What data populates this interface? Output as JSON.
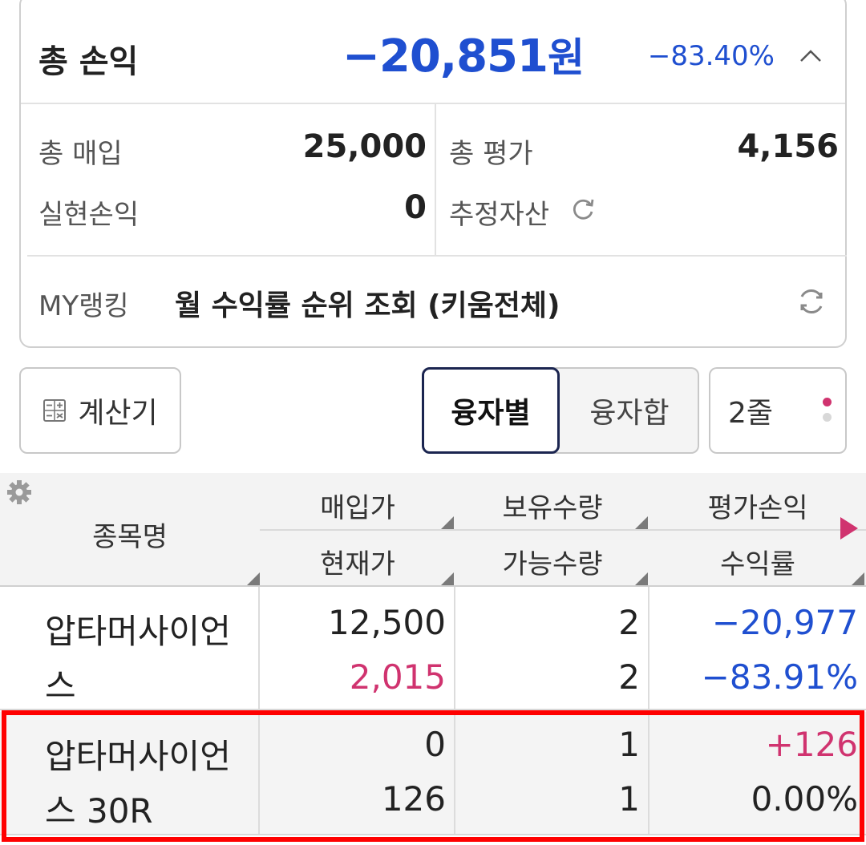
{
  "summary": {
    "total_label": "총 손익",
    "total_amount": "−20,851",
    "total_unit": "원",
    "total_rate": "−83.40%",
    "purchase_label": "총 매입",
    "purchase_value": "25,000",
    "eval_label": "총 평가",
    "eval_value": "4,156",
    "realized_label": "실현손익",
    "realized_value": "0",
    "est_asset_label": "추정자산"
  },
  "ranking": {
    "label": "MY랭킹",
    "text": "월 수익률 순위 조회 (키움전체)"
  },
  "controls": {
    "calculator": "계산기",
    "seg_a": "융자별",
    "seg_b": "융자합",
    "lines": "2줄"
  },
  "table": {
    "headers": {
      "name": "종목명",
      "buy_price": "매입가",
      "current_price": "현재가",
      "holding_qty": "보유수량",
      "available_qty": "가능수량",
      "eval_pl": "평가손익",
      "return_rate": "수익률"
    },
    "rows": [
      {
        "name": "압타머사이언스",
        "buy_price": "12,500",
        "current_price": "2,015",
        "holding_qty": "2",
        "available_qty": "2",
        "eval_pl": "−20,977",
        "return_rate": "−83.91%"
      },
      {
        "name": "압타머사이언스 30R",
        "buy_price": "0",
        "current_price": "126",
        "holding_qty": "1",
        "available_qty": "1",
        "eval_pl": "+126",
        "return_rate": "0.00%"
      }
    ]
  },
  "colors": {
    "negative": "#1f4fd0",
    "positive": "#d0336f",
    "highlight": "#ff0000",
    "segment_border": "#1b2550"
  },
  "icons": [
    "chevron-up-icon",
    "refresh-icon",
    "calculator-icon",
    "settings-gear-icon",
    "more-dots-icon",
    "scroll-right-arrow-icon"
  ]
}
